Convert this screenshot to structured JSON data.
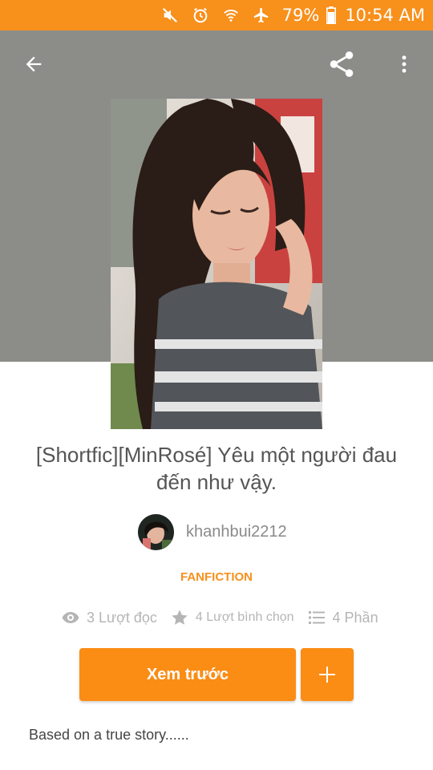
{
  "status_bar": {
    "battery": "79%",
    "time": "10:54 AM",
    "icons": [
      "mute-icon",
      "alarm-icon",
      "wifi-icon",
      "airplane-mode-icon",
      "battery-icon"
    ]
  },
  "toolbar": {
    "icons": [
      "back-arrow-icon",
      "share-icon",
      "more-vert-icon"
    ]
  },
  "story": {
    "title": "[Shortfic][MinRosé] Yêu một người đau đến như vậy.",
    "author": "khanhbui2212",
    "category": "FANFICTION",
    "stats": {
      "reads": "3 Lượt đọc",
      "votes": "4 Lượt bình chọn",
      "parts": "4 Phần"
    },
    "preview_label": "Xem trước",
    "add_label": "+",
    "description": "Based on a true story......"
  },
  "colors": {
    "accent": "#f8901c",
    "button": "#fb8c14",
    "hero_bg": "#8c8c89",
    "muted": "#b5b5b5"
  }
}
